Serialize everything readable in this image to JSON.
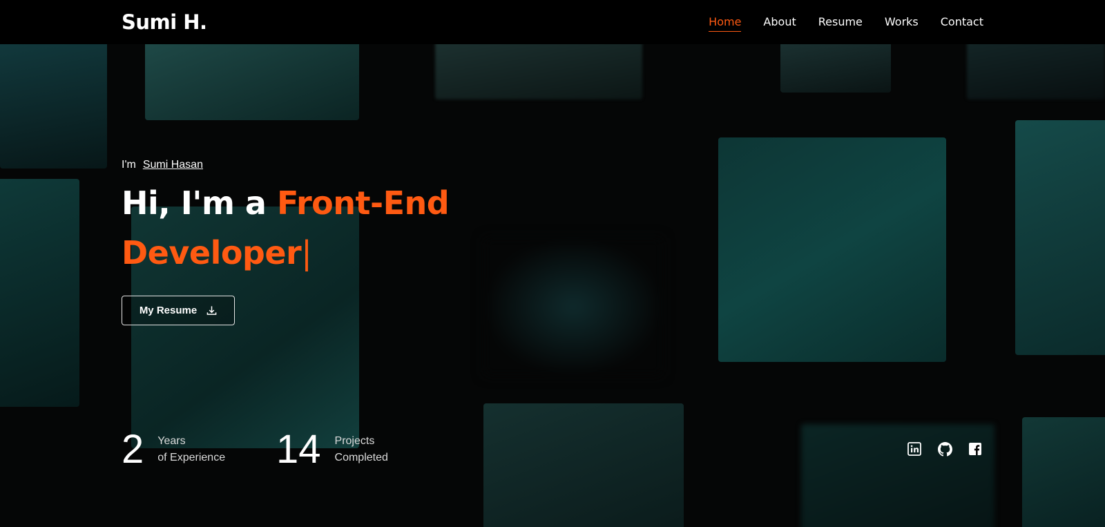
{
  "header": {
    "logo": "Sumi H.",
    "nav": [
      {
        "label": "Home",
        "active": true
      },
      {
        "label": "About",
        "active": false
      },
      {
        "label": "Resume",
        "active": false
      },
      {
        "label": "Works",
        "active": false
      },
      {
        "label": "Contact",
        "active": false
      }
    ]
  },
  "hero": {
    "intro_prefix": "I'm",
    "intro_name": "Sumi Hasan",
    "headline_prefix": "Hi, I'm a ",
    "headline_role_line1": "Front-End",
    "headline_role_line2": "Developer",
    "typing_cursor": "|",
    "resume_button": "My Resume",
    "resume_icon": "download-icon"
  },
  "stats": [
    {
      "value": "2",
      "label_line1": "Years",
      "label_line2": "of Experience"
    },
    {
      "value": "14",
      "label_line1": "Projects",
      "label_line2": "Completed"
    }
  ],
  "social": [
    {
      "icon": "linkedin-icon"
    },
    {
      "icon": "github-icon"
    },
    {
      "icon": "facebook-icon"
    }
  ],
  "colors": {
    "accent": "#ff5a12",
    "background": "#050606",
    "header": "#000000",
    "cube_teal": "#0d3a38"
  }
}
